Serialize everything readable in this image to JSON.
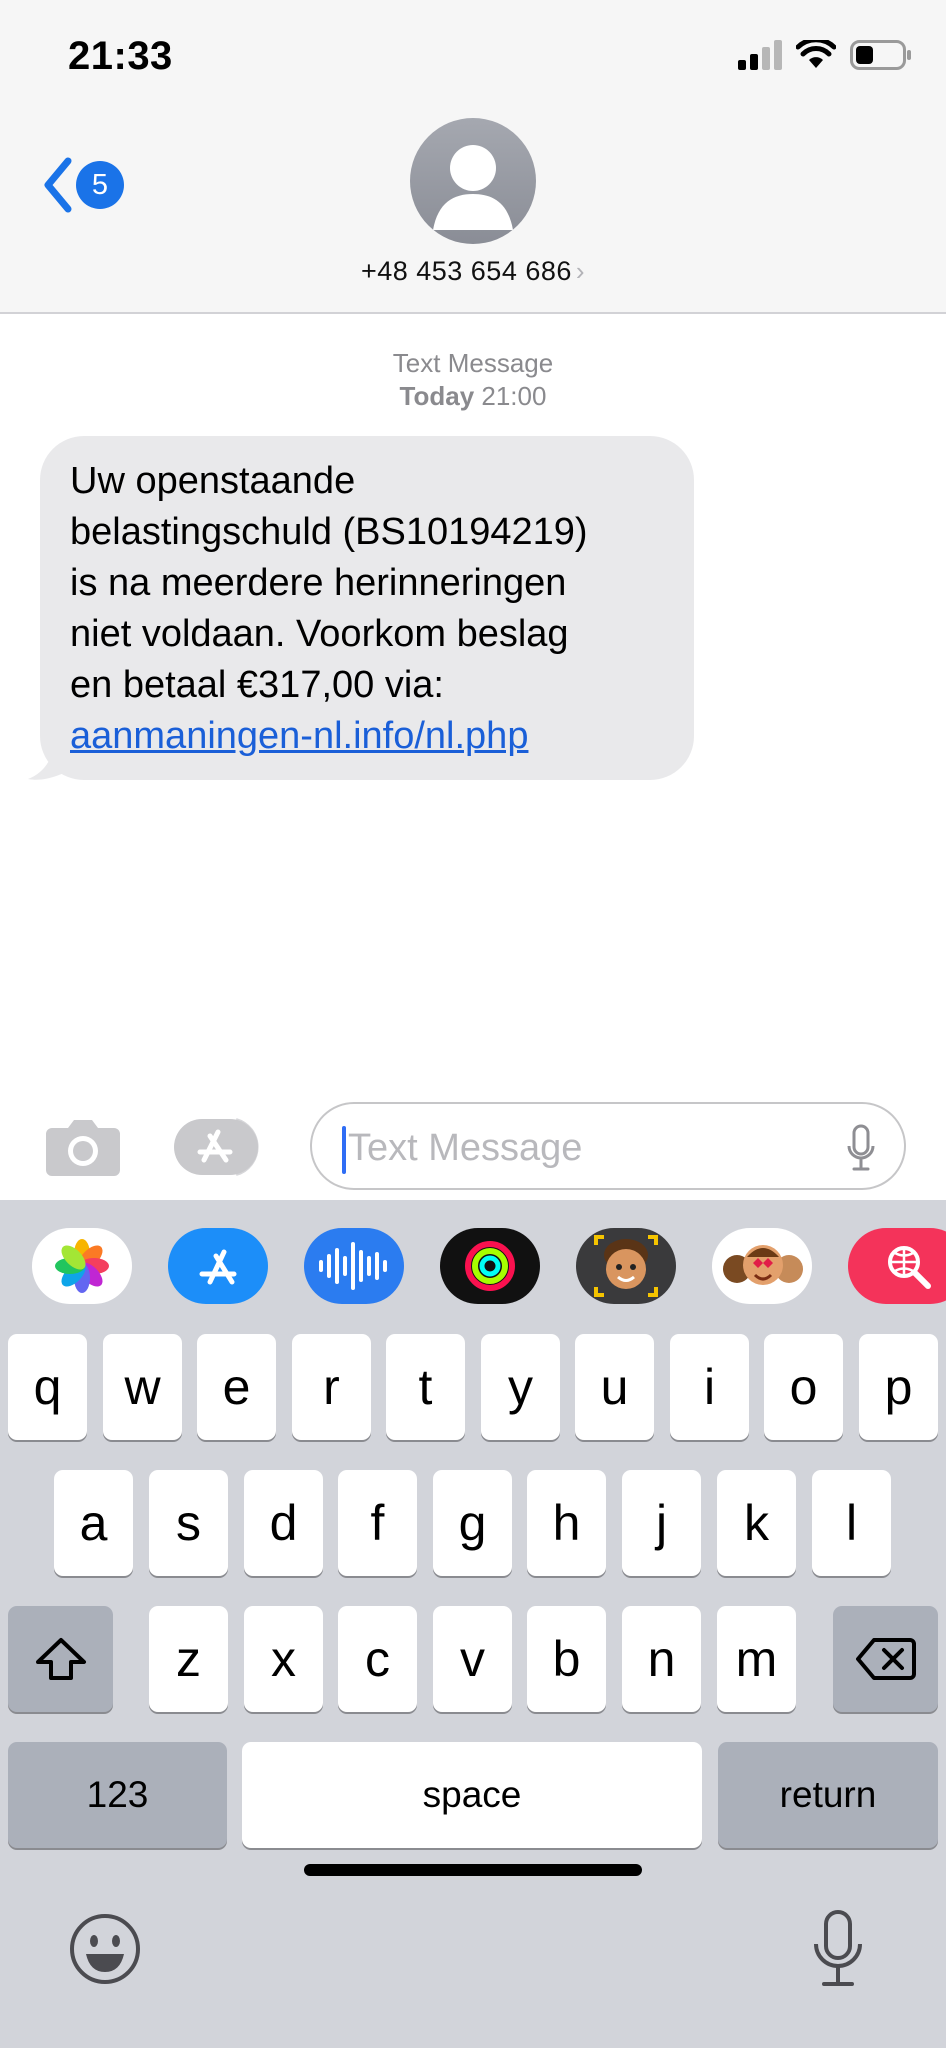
{
  "status_bar": {
    "time": "21:33",
    "icons": [
      "cellular-signal-icon",
      "wifi-icon",
      "battery-icon"
    ]
  },
  "header": {
    "back_badge_count": "5",
    "contact_number": "+48 453 654 686",
    "icons": [
      "chevron-left-icon",
      "person-avatar-icon",
      "chevron-right-icon"
    ]
  },
  "conversation": {
    "service_label": "Text Message",
    "date_label": "Today",
    "time_label": "21:00",
    "message": {
      "lines": [
        "Uw openstaande",
        "belastingschuld (BS10194219)",
        "is na meerdere herinneringen",
        "niet voldaan. Voorkom beslag",
        "en betaal €317,00 via:"
      ],
      "link": "aanmaningen-nl.info/nl.php"
    }
  },
  "input_bar": {
    "placeholder": "Text Message",
    "value": "",
    "icons": [
      "camera-icon",
      "app-store-icon",
      "microphone-icon"
    ]
  },
  "app_strip": {
    "apps": [
      "photos-app-icon",
      "app-store-app-icon",
      "audio-message-app-icon",
      "activity-app-icon",
      "memoji-app-icon",
      "memoji-stickers-app-icon",
      "web-search-app-icon"
    ]
  },
  "keyboard": {
    "row1": [
      "q",
      "w",
      "e",
      "r",
      "t",
      "y",
      "u",
      "i",
      "o",
      "p"
    ],
    "row2": [
      "a",
      "s",
      "d",
      "f",
      "g",
      "h",
      "j",
      "k",
      "l"
    ],
    "row3": [
      "z",
      "x",
      "c",
      "v",
      "b",
      "n",
      "m"
    ],
    "numbers_label": "123",
    "space_label": "space",
    "return_label": "return",
    "icons": [
      "shift-icon",
      "delete-icon",
      "emoji-icon",
      "dictation-mic-icon"
    ]
  },
  "colors": {
    "accent_blue": "#1a73e8",
    "link_blue": "#1a5fd8",
    "bubble_gray": "#e9e9eb",
    "keyboard_bg": "#d2d4da",
    "header_bg": "#f6f6f6"
  }
}
